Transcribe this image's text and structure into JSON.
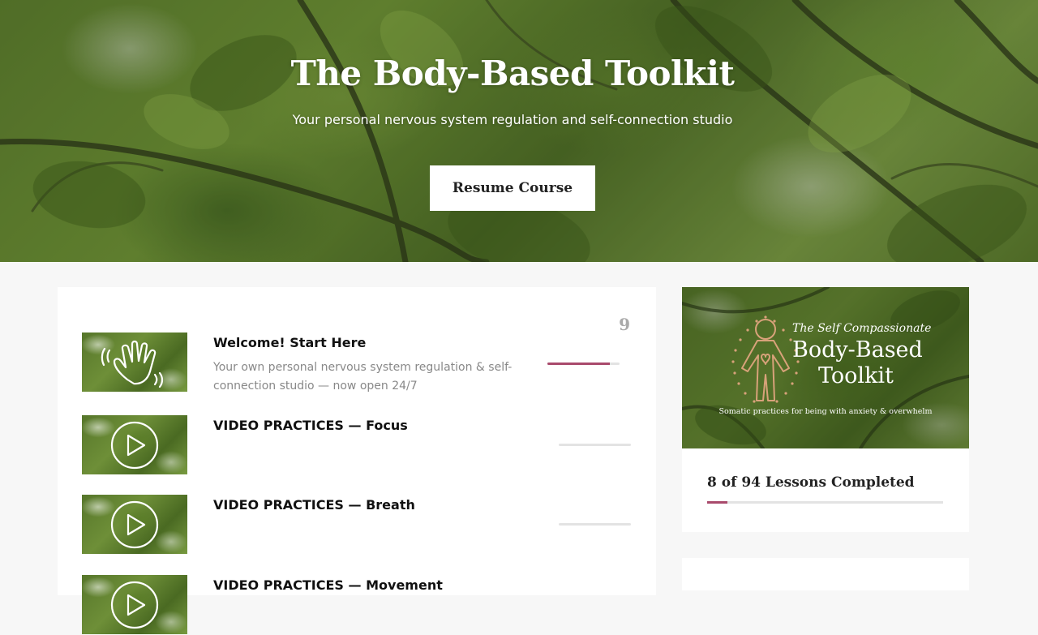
{
  "hero": {
    "title": "The Body-Based Toolkit",
    "subtitle": "Your personal nervous system regulation and self-connection studio",
    "resume_label": "Resume Course"
  },
  "course": {
    "section_count": "9",
    "lessons": [
      {
        "title": "Welcome! Start Here",
        "description": "Your own personal nervous system regulation & self-connection studio — now open 24/7",
        "icon": "waving-hand-icon",
        "progress": 0.87
      },
      {
        "title": "VIDEO PRACTICES — Focus",
        "description": "",
        "icon": "play-icon",
        "progress": 0
      },
      {
        "title": "VIDEO PRACTICES — Breath",
        "description": "",
        "icon": "play-icon",
        "progress": 0
      },
      {
        "title": "VIDEO PRACTICES — Movement",
        "description": "",
        "icon": "play-icon",
        "progress": 0
      }
    ]
  },
  "sidebar": {
    "cover": {
      "kicker": "The Self Compassionate",
      "title_line1": "Body-Based",
      "title_line2": "Toolkit",
      "tagline": "Somatic practices for being with anxiety & overwhelm"
    },
    "lessons_completed_label": "8 of 94 Lessons Completed",
    "completed": 8,
    "total": 94
  },
  "colors": {
    "accent": "#a94a6c",
    "track": "#e3e3e3",
    "cover_figure": "#d8a27a"
  }
}
